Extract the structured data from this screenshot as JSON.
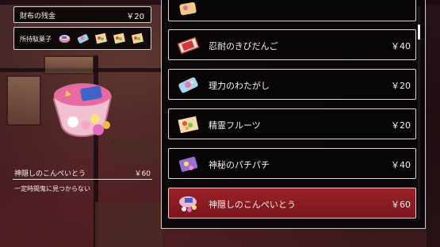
{
  "wallet": {
    "label": "財布の残金",
    "amount": "￥20"
  },
  "candies": {
    "label": "所持駄菓子",
    "icons": [
      "tin-candy-icon",
      "cotton-candy-icon",
      "fruit-candy-icon",
      "fruit-candy-icon",
      "fruit-candy-icon"
    ]
  },
  "detail": {
    "name": "神隠しのこんぺいとう",
    "price": "￥60",
    "description": "一定時間鬼に見つからない"
  },
  "shop_items": [
    {
      "name": "",
      "price": "",
      "icon": "sweets-icon"
    },
    {
      "name": "忍耐のきびだんご",
      "price": "￥40",
      "icon": "kibidango-icon"
    },
    {
      "name": "理力のわたがし",
      "price": "￥20",
      "icon": "cotton-candy-icon"
    },
    {
      "name": "精霊フルーツ",
      "price": "￥20",
      "icon": "fruit-candy-icon"
    },
    {
      "name": "神秘のパチパチ",
      "price": "￥40",
      "icon": "popping-candy-icon"
    },
    {
      "name": "神隠しのこんぺいとう",
      "price": "￥60",
      "icon": "konpeito-icon",
      "selected": true
    }
  ],
  "colors": {
    "selected": "#8c1c23",
    "panel": "#080506",
    "border": "#dcd6d4"
  }
}
